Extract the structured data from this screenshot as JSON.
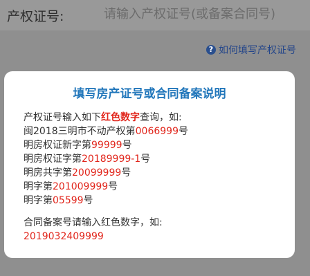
{
  "form": {
    "label": "产权证号:",
    "placeholder": "请输入产权证号(或备案合同号)"
  },
  "help": {
    "icon": "question-circle-icon",
    "label": "如何填写产权证号"
  },
  "dialog": {
    "title": "填写房产证号或合同备案说明",
    "intro": {
      "a": "产权证号输入如下",
      "b": "红色数字",
      "c": "查询，如:"
    },
    "examples": [
      {
        "prefix": "闽2018三明市不动产权第",
        "num": "0066999",
        "suffix": "号"
      },
      {
        "prefix": "明房权证新字第",
        "num": "99999",
        "suffix": "号"
      },
      {
        "prefix": "明房权证字第",
        "num": "20189999-1",
        "suffix": "号"
      },
      {
        "prefix": "明房共字第",
        "num": "20099999",
        "suffix": "号"
      },
      {
        "prefix": "明字第",
        "num": "201009999",
        "suffix": "号"
      },
      {
        "prefix": "明字第",
        "num": "05599",
        "suffix": "号"
      }
    ],
    "contract": {
      "text": "合同备案号请输入红色数字，如:",
      "number": "2019032409999"
    }
  },
  "colors": {
    "accent_red": "#e1251b",
    "title_blue": "#2277bb",
    "link_blue": "#24468a"
  }
}
